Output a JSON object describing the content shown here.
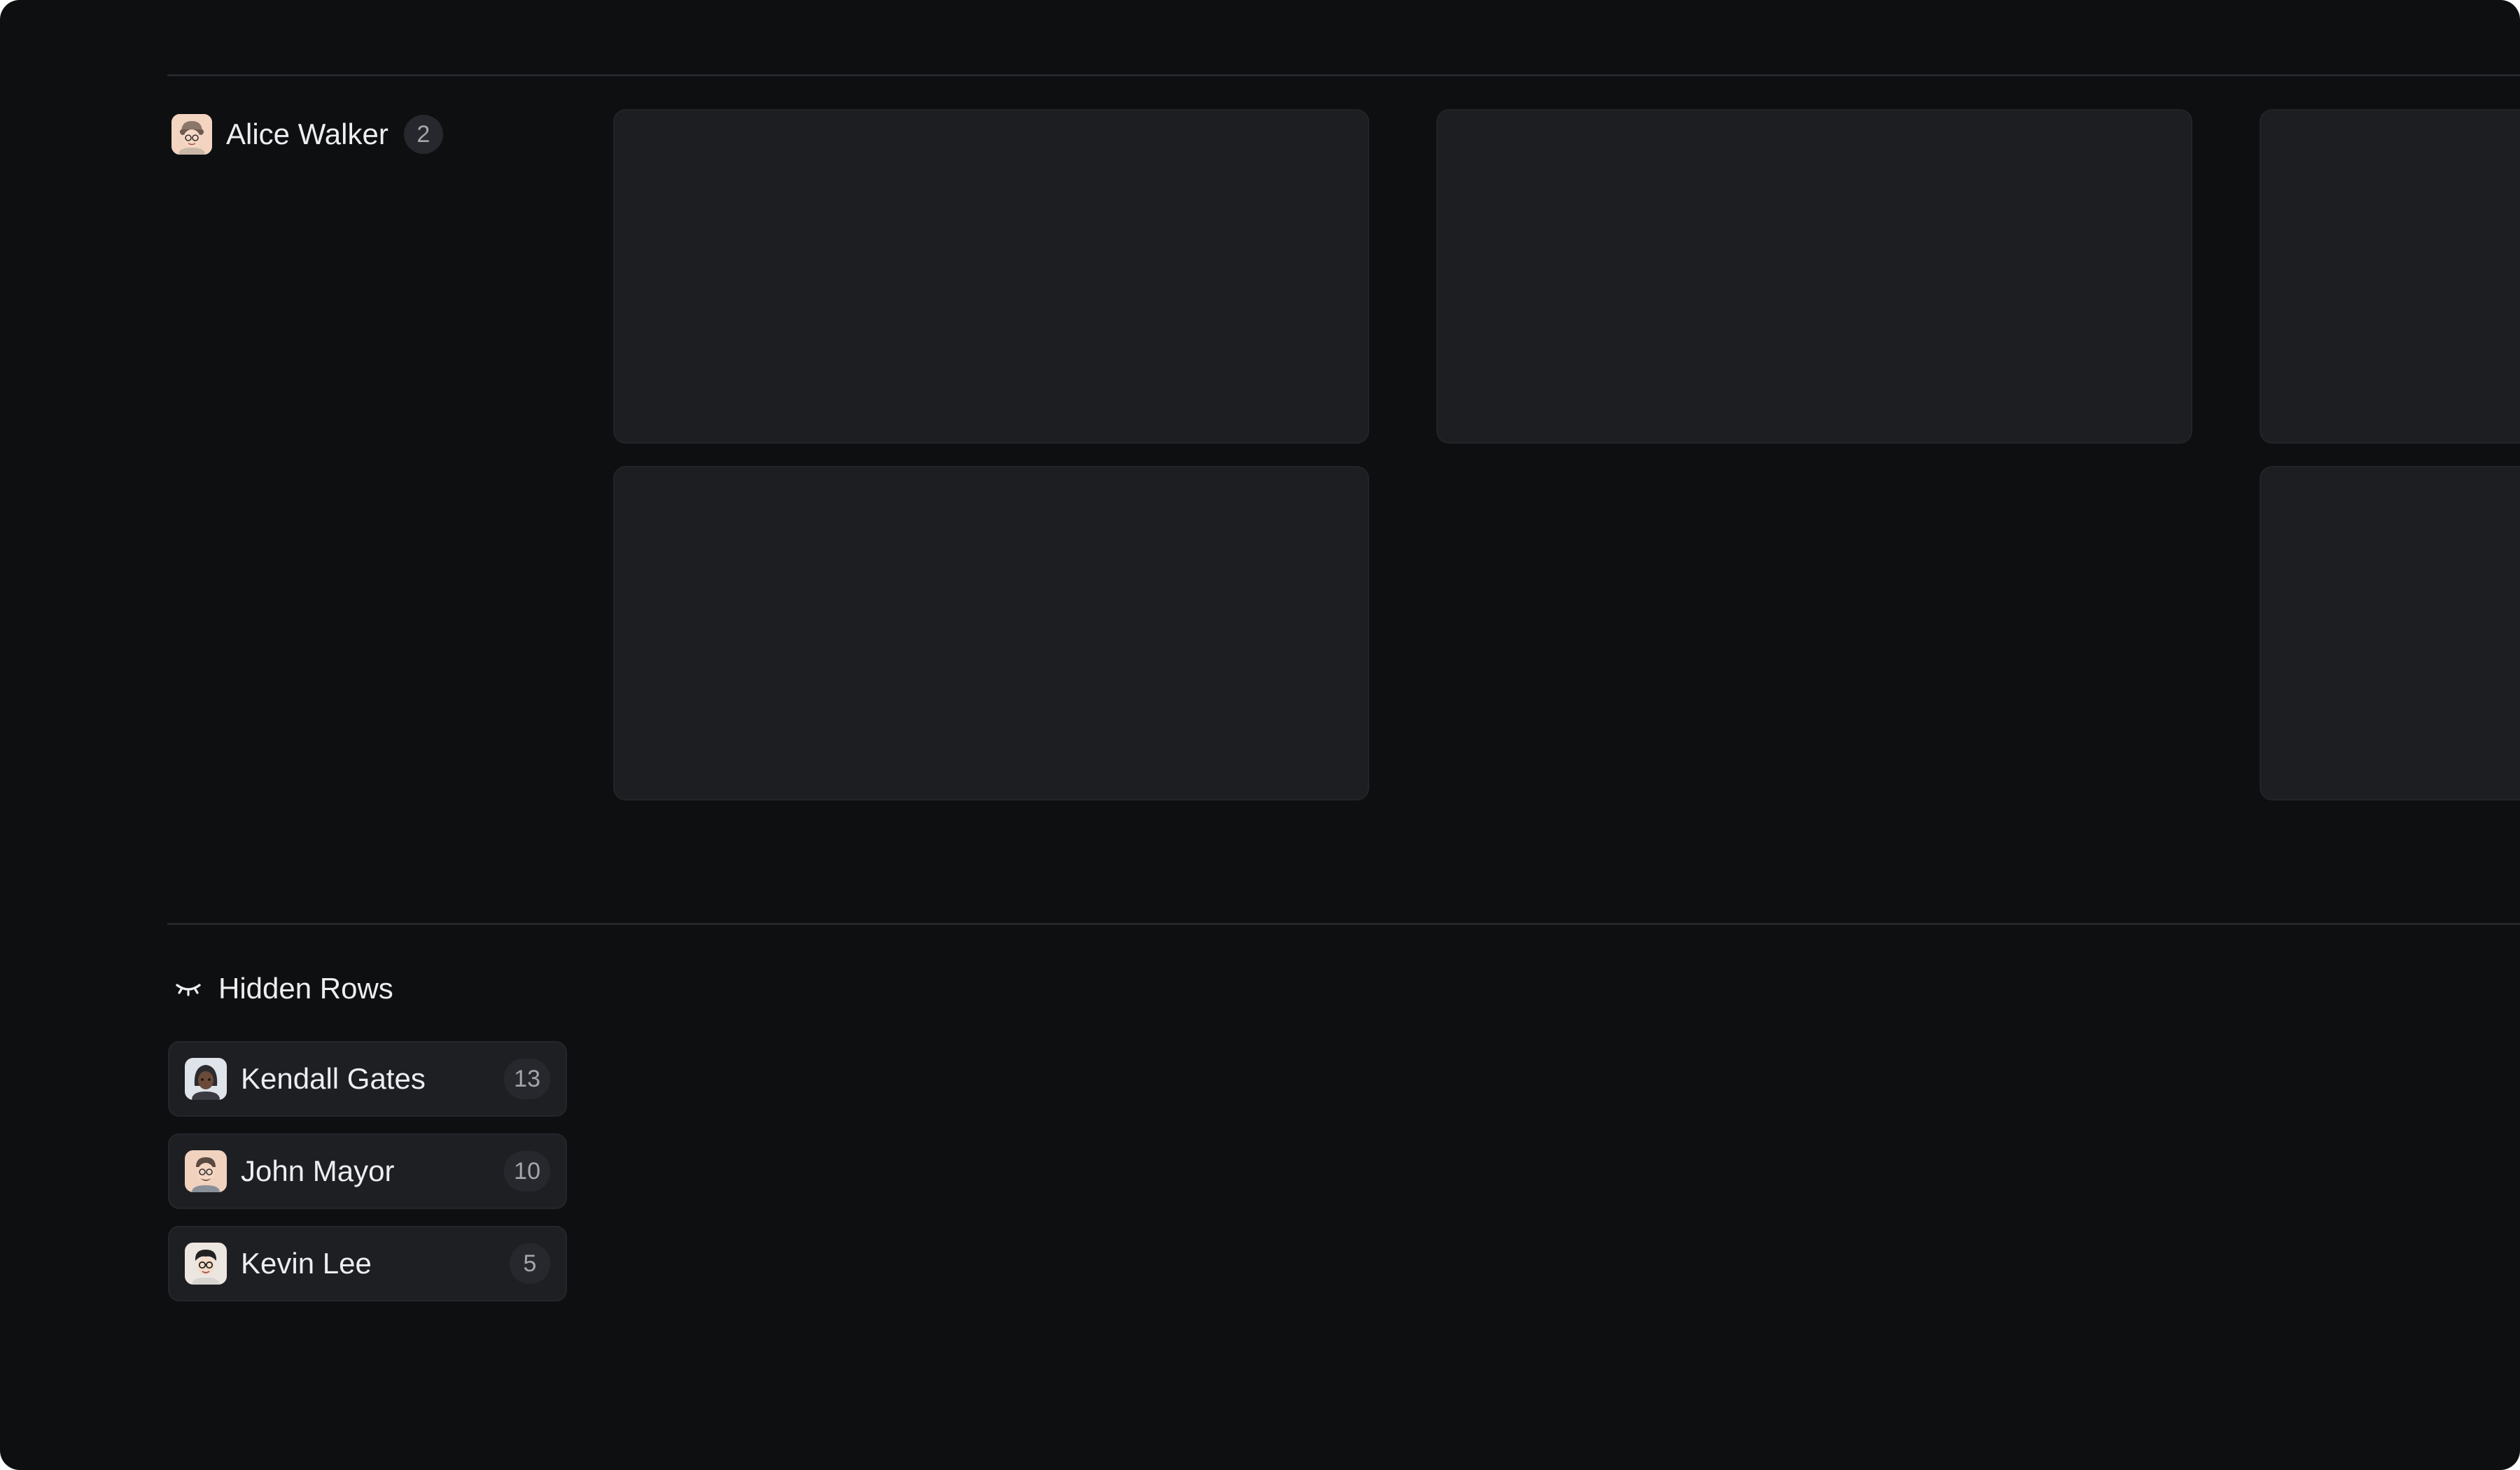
{
  "board": {
    "group": {
      "name": "Alice Walker",
      "count": "2",
      "avatar_icon": "alice-walker-avatar-icon"
    },
    "card_count": 5
  },
  "hidden_rows": {
    "title": "Hidden Rows",
    "icon": "eye-closed-icon",
    "items": [
      {
        "name": "Kendall Gates",
        "count": "13",
        "avatar_icon": "kendall-gates-avatar-icon"
      },
      {
        "name": "John Mayor",
        "count": "10",
        "avatar_icon": "john-mayor-avatar-icon"
      },
      {
        "name": "Kevin Lee",
        "count": "5",
        "avatar_icon": "kevin-lee-avatar-icon"
      }
    ]
  },
  "colors": {
    "background": "#0e0f11",
    "card": "#1d1e22",
    "text": "#eceef1",
    "badge": "#26282d",
    "badge_text": "#a3a6ad"
  }
}
